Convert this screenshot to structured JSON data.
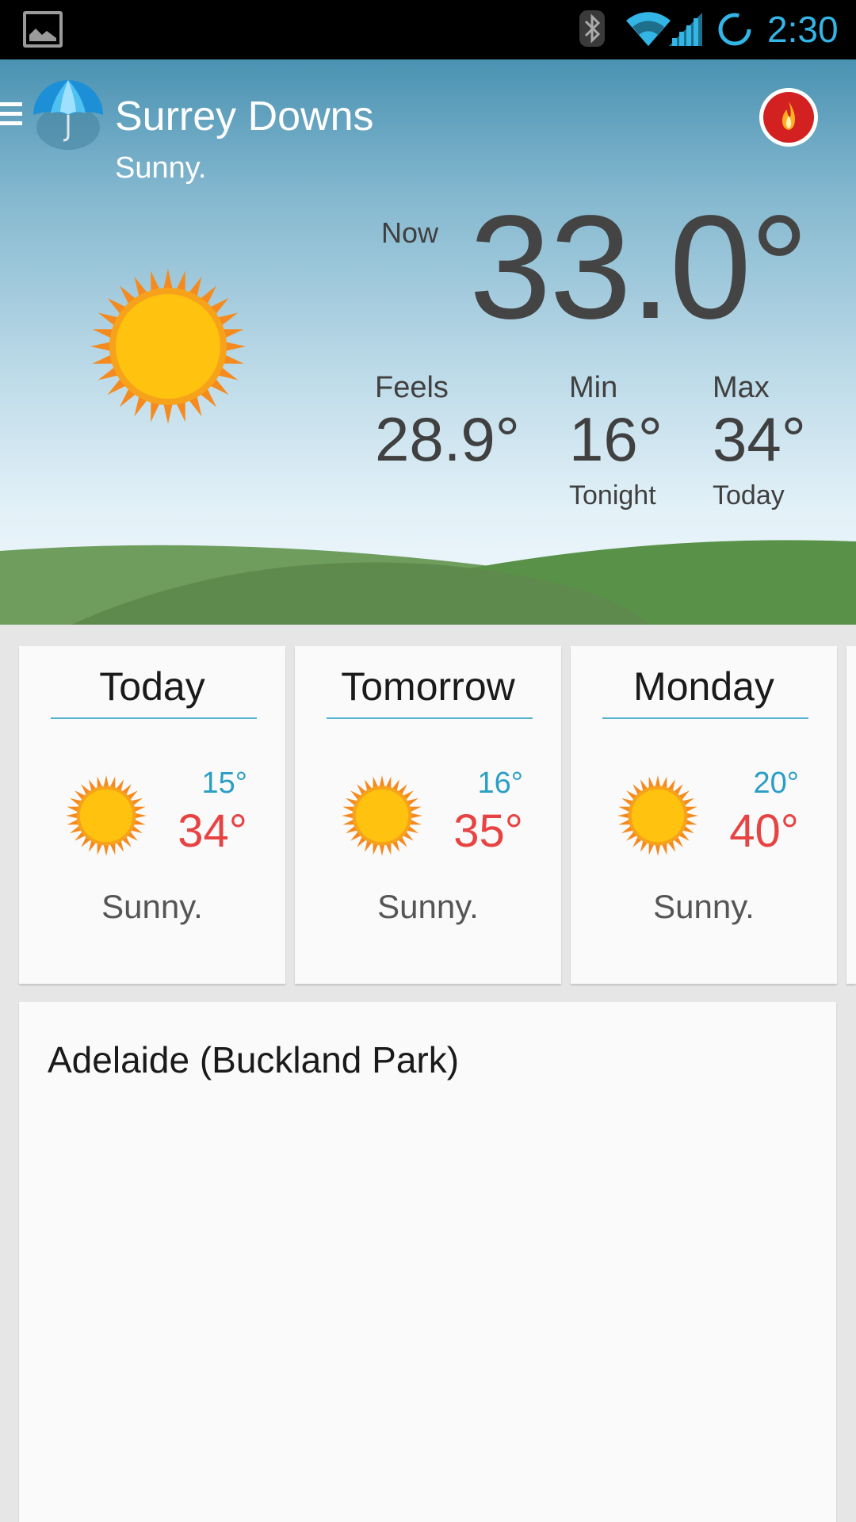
{
  "status_bar": {
    "time": "2:30",
    "time_color": "#33b5e5",
    "icons": [
      "image-icon",
      "bluetooth-icon",
      "wifi-icon",
      "signal-icon",
      "sync-icon"
    ]
  },
  "header": {
    "location": "Surrey Downs",
    "condition": "Sunny."
  },
  "current": {
    "now_label": "Now",
    "temperature": "33.0°",
    "feels_label": "Feels",
    "feels_value": "28.9°",
    "min_label": "Min",
    "min_value": "16°",
    "min_sub": "Tonight",
    "max_label": "Max",
    "max_value": "34°",
    "max_sub": "Today"
  },
  "forecast": [
    {
      "day": "Today",
      "min": "15°",
      "max": "34°",
      "desc": "Sunny.",
      "icon": "sun-icon"
    },
    {
      "day": "Tomorrow",
      "min": "16°",
      "max": "35°",
      "desc": "Sunny.",
      "icon": "sun-icon"
    },
    {
      "day": "Monday",
      "min": "20°",
      "max": "40°",
      "desc": "Sunny.",
      "icon": "sun-icon"
    }
  ],
  "station": {
    "name": "Adelaide (Buckland Park)"
  },
  "colors": {
    "min_temp": "#2a9ec6",
    "max_temp": "#e84343",
    "divider": "#56b3cf",
    "fire_button": "#d32020"
  }
}
